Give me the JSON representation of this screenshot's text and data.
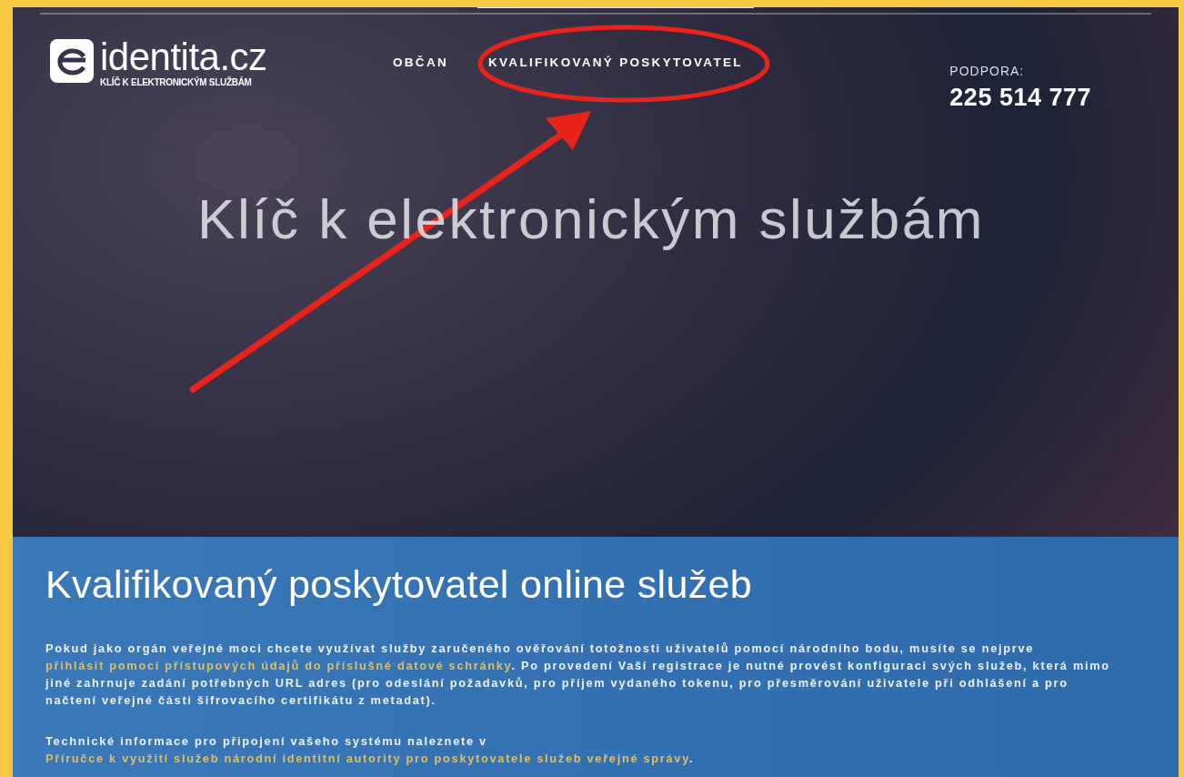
{
  "header": {
    "logo_text": "identita.cz",
    "logo_tagline": "KLÍČ K ELEKTRONICKÝM SLUŽBÁM",
    "nav": [
      {
        "label": "OBČAN",
        "selected": false
      },
      {
        "label": "KVALIFIKOVANÝ POSKYTOVATEL",
        "selected": true
      }
    ],
    "support": {
      "label": "PODPORA:",
      "phone": "225 514 777"
    }
  },
  "hero": {
    "title": "Klíč k elektronickým službám"
  },
  "panel": {
    "title": "Kvalifikovaný poskytovatel online služeb",
    "paragraphs": [
      [
        {
          "kind": "text",
          "text": "Pokud jako orgán veřejné moci chcete využívat služby zaručeného ověřování totožnosti uživatelů pomocí národního bodu, musíte se nejprve "
        },
        {
          "kind": "link",
          "text": "přihlásit pomocí přístupových údajů do příslušné datové schránky"
        },
        {
          "kind": "text",
          "text": ". Po provedení Vaší registrace je nutné provést konfiguraci svých služeb, která mimo jiné zahrnuje zadání potřebných URL adres (pro odeslání požadavků, pro příjem vydaného tokenu, pro přesměrování uživatele při odhlášení a pro načtení veřejné části šifrovacího certifikátu z metadat)."
        }
      ],
      [
        {
          "kind": "text",
          "text": "Technické informace pro připojení vašeho systému naleznete v "
        },
        {
          "kind": "link",
          "text": "Příručce k využití služeb národní identitní autority pro poskytovatele služeb veřejné správy"
        },
        {
          "kind": "text",
          "text": "."
        }
      ]
    ]
  }
}
